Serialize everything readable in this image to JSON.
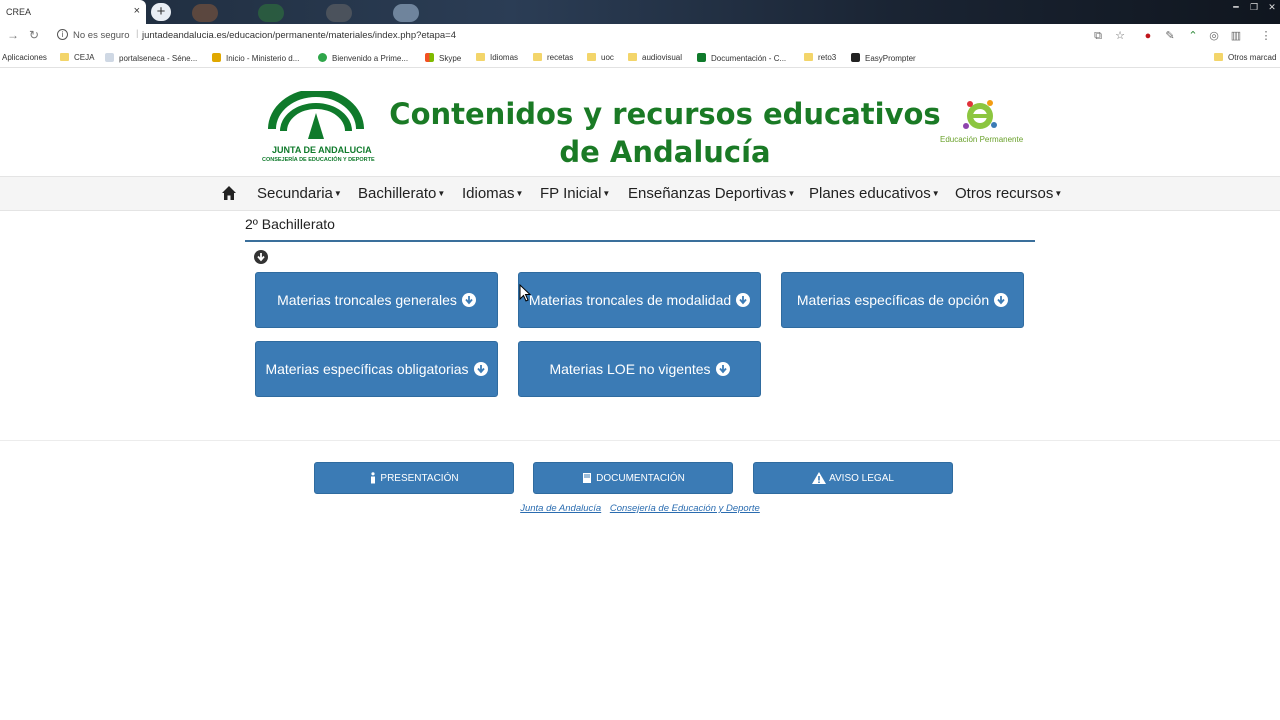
{
  "browser": {
    "tab_title": "CREA",
    "tab_close": "×",
    "new_tab": "+",
    "security_label": "No es seguro",
    "url": "juntadeandalucia.es/educacion/permanente/materiales/index.php?etapa=4",
    "bookmarks": [
      {
        "label": "Aplicaciones",
        "icon": "apps-icon"
      },
      {
        "label": "CEJA",
        "icon": "folder-icon"
      },
      {
        "label": "portalseneca - Séne...",
        "icon": "page-icon"
      },
      {
        "label": "Inicio - Ministerio d...",
        "icon": "ministry-icon"
      },
      {
        "label": "Bienvenido a Prime...",
        "icon": "prime-icon"
      },
      {
        "label": "Skype",
        "icon": "windows-icon"
      },
      {
        "label": "Idiomas",
        "icon": "folder-icon"
      },
      {
        "label": "recetas",
        "icon": "folder-icon"
      },
      {
        "label": "uoc",
        "icon": "folder-icon"
      },
      {
        "label": "audiovisual",
        "icon": "folder-icon"
      },
      {
        "label": "Documentación - C...",
        "icon": "junta-icon"
      },
      {
        "label": "reto3",
        "icon": "folder-icon"
      },
      {
        "label": "EasyPrompter",
        "icon": "prompter-icon"
      },
      {
        "label": "Otros marcad",
        "icon": "folder-icon"
      }
    ]
  },
  "header": {
    "logo_line1": "JUNTA DE ANDALUCIA",
    "logo_line2": "CONSEJERÍA DE EDUCACIÓN Y DEPORTE",
    "title_line1": "Contenidos y recursos educativos",
    "title_line2": "de Andalucía",
    "ep_logo_text": "Educación Permanente",
    "colors": {
      "title": "#1a7a25",
      "button": "#3b7bb5",
      "link": "#2a6cb0"
    }
  },
  "nav": {
    "items": [
      "Secundaria",
      "Bachillerato",
      "Idiomas",
      "FP Inicial",
      "Enseñanzas Deportivas",
      "Planes educativos",
      "Otros recursos"
    ]
  },
  "main": {
    "breadcrumb": "2º Bachillerato",
    "buttons": [
      "Materias troncales generales",
      "Materias troncales de modalidad",
      "Materias específicas de opción",
      "Materias específicas obligatorias",
      "Materias LOE no vigentes"
    ]
  },
  "footer": {
    "buttons": [
      "PRESENTACIÓN",
      "DOCUMENTACIÓN",
      "AVISO LEGAL"
    ],
    "links": [
      "Junta de Andalucía",
      "Consejería de Educación y Deporte"
    ]
  }
}
